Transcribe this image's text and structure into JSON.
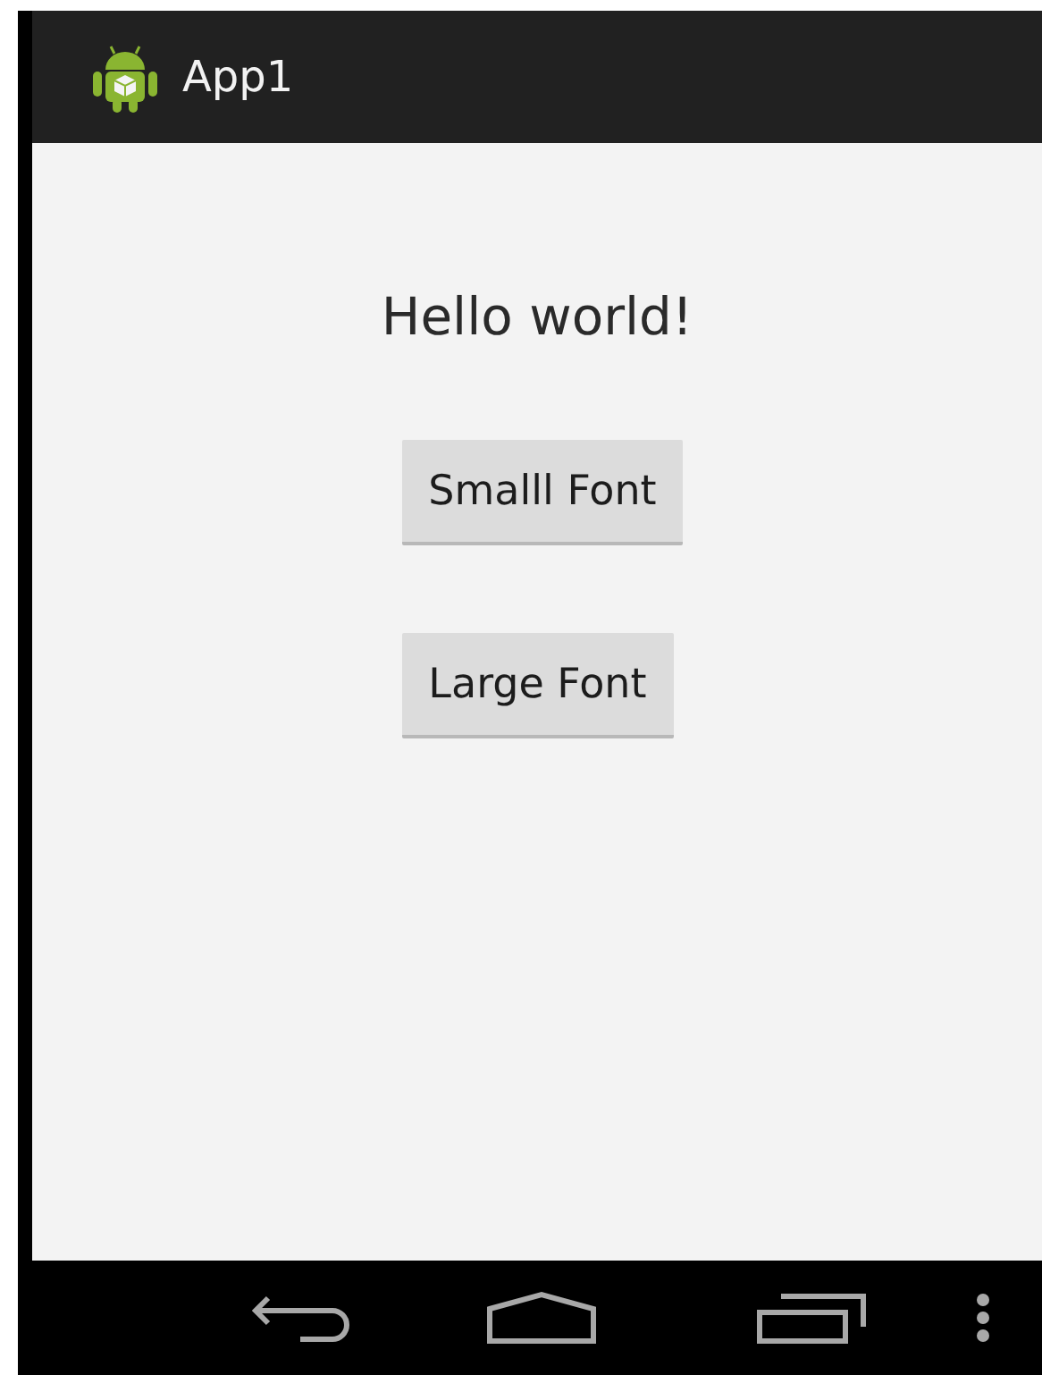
{
  "action_bar": {
    "title": "App1"
  },
  "greeting": "Hello world!",
  "buttons": [
    {
      "label": "Smalll Font"
    },
    {
      "label": "Large Font"
    }
  ]
}
